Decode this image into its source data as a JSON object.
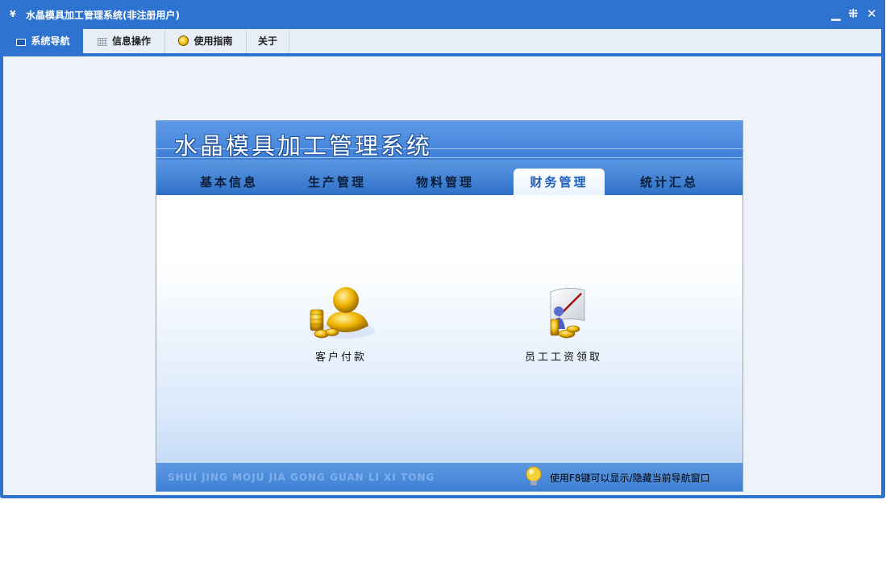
{
  "window": {
    "title": "水晶模具加工管理系统(非注册用户)",
    "app_icon": "y-logo-icon",
    "controls": [
      "minimize-icon",
      "restore-icon",
      "close-icon"
    ],
    "minimize_glyph": "▁",
    "restore_glyph": "⁜",
    "close_glyph": "✕"
  },
  "menu": {
    "items": [
      {
        "label": "系统导航",
        "icon": "monitor-icon",
        "active": true
      },
      {
        "label": "信息操作",
        "icon": "grid-icon",
        "active": false
      },
      {
        "label": "使用指南",
        "icon": "bulb-icon",
        "active": false
      },
      {
        "label": "关于",
        "icon": "",
        "active": false
      }
    ]
  },
  "panel": {
    "banner_title": "水晶模具加工管理系统",
    "tabs": [
      "基本信息",
      "生产管理",
      "物料管理",
      "财务管理",
      "统计汇总"
    ],
    "active_tab": "财务管理",
    "functions": [
      {
        "label": "客户付款",
        "icon": "gold-person-coins-icon"
      },
      {
        "label": "员工工资领取",
        "icon": "employee-chart-coins-icon"
      }
    ],
    "footer_pinyin": "SHUI JING MOJU JIA GONG GUAN LI XI TONG",
    "footer_hint": "使用F8键可以显示/隐藏当前导航窗口"
  },
  "colors": {
    "accent": "#2f73d0",
    "banner": "#4f8ee0",
    "background": "#edf3f8"
  }
}
